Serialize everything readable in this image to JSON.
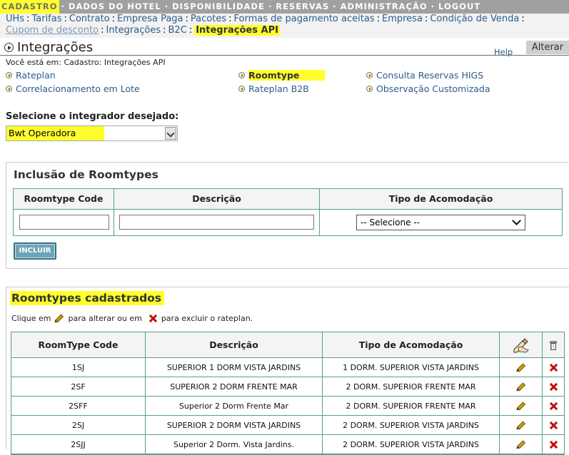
{
  "topnav": {
    "items": [
      "CADASTRO",
      "DADOS DO HOTEL",
      "DISPONIBILIDADE",
      "RESERVAS",
      "ADMINISTRAÇÃO",
      "LOGOUT"
    ],
    "separator": "·"
  },
  "subnav": {
    "line1": [
      "UHs",
      "Tarifas",
      "Contrato",
      "Empresa Paga",
      "Pacotes",
      "Formas de pagamento aceitas",
      "Empresa",
      "Condição de Venda"
    ],
    "line2": [
      "Cupom de desconto",
      "Integrações",
      "B2C",
      "Integrações API"
    ],
    "separator": ":"
  },
  "header": {
    "title": "Integrações",
    "help": "Help",
    "alterar": "Alterar",
    "breadcrumb": "Você está em: Cadastro: Integrações API"
  },
  "menu": {
    "rateplan": "Rateplan",
    "roomtype": "Roomtype",
    "consulta": "Consulta Reservas HIGS",
    "correlacionamento": "Correlacionamento em Lote",
    "rateplan_b2b": "Rateplan B2B",
    "observacao": "Observação Customizada"
  },
  "integrator": {
    "label": "Selecione o integrador desejado:",
    "selected": "Bwt Operadora"
  },
  "inclusion": {
    "title": "Inclusão de Roomtypes",
    "col_code": "Roomtype Code",
    "col_desc": "Descrição",
    "col_tipo": "Tipo de Acomodação",
    "select_placeholder": "-- Selecione --",
    "button": "INCLUIR"
  },
  "registered": {
    "title": "Roomtypes cadastrados",
    "hint_pre": "Clique em",
    "hint_mid": "para alterar ou em",
    "hint_post": "para excluir o rateplan.",
    "headers": [
      "RoomType Code",
      "Descrição",
      "Tipo de Acomodação"
    ],
    "rows": [
      {
        "code": "1SJ",
        "desc": "SUPERIOR 1 DORM VISTA JARDINS",
        "tipo": "1 DORM. SUPERIOR VISTA JARDINS"
      },
      {
        "code": "2SF",
        "desc": "SUPERIOR 2 DORM FRENTE MAR",
        "tipo": "2 DORM. SUPERIOR FRENTE MAR"
      },
      {
        "code": "2SFF",
        "desc": "Superior 2 Dorm Frente Mar",
        "tipo": "2 DORM. SUPERIOR FRENTE MAR"
      },
      {
        "code": "2SJ",
        "desc": "SUPERIOR 2 DORM VISTA JARDINS",
        "tipo": "2 DORM. SUPERIOR VISTA JARDINS"
      },
      {
        "code": "2SJJ",
        "desc": "Superior 2 Dorm. Vista Jardins.",
        "tipo": "2 DORM. SUPERIOR VISTA JARDINS"
      }
    ]
  }
}
